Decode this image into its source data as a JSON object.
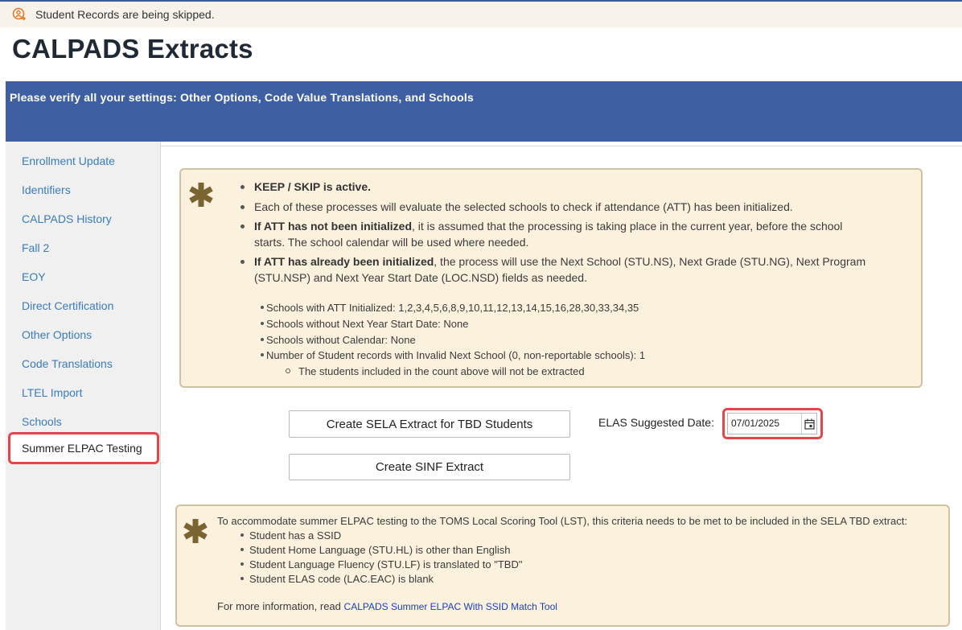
{
  "notice": {
    "text": "Student Records are being skipped.",
    "icon": "person-skip-icon"
  },
  "page": {
    "title": "CALPADS Extracts"
  },
  "banner": {
    "text": "Please verify all your settings: Other Options, Code Value Translations, and Schools"
  },
  "sidebar": {
    "items": [
      {
        "label": "Enrollment Update"
      },
      {
        "label": "Identifiers"
      },
      {
        "label": "CALPADS History"
      },
      {
        "label": "Fall 2"
      },
      {
        "label": "EOY"
      },
      {
        "label": "Direct Certification"
      },
      {
        "label": "Other Options"
      },
      {
        "label": "Code Translations"
      },
      {
        "label": "LTEL Import"
      },
      {
        "label": "Schools"
      }
    ],
    "active": {
      "label": "Summer ELPAC Testing"
    }
  },
  "info": {
    "b1": "KEEP / SKIP is active.",
    "b2": "Each of these processes will evaluate the selected schools to check if attendance (ATT) has been initialized.",
    "b3_bold": "If ATT has not been initialized",
    "b3_line1": ", it is assumed that the processing is taking place in the current year, before the school",
    "b3_line2": "starts. The school calendar will be used where needed.",
    "b4_bold": "If ATT has already been initialized",
    "b4_line1": ", the process will use the Next School (STU.NS), Next Grade (STU.NG), Next Program",
    "b4_line2": "(STU.NSP) and Next Year Start Date (LOC.NSD) fields as needed.",
    "details": [
      "Schools with ATT Initialized: 1,2,3,4,5,6,8,9,10,11,12,13,14,15,16,28,30,33,34,35",
      "Schools without Next Year Start Date: None",
      "Schools without Calendar: None",
      "Number of Student records with Invalid Next School (0, non-reportable schools): 1"
    ],
    "sub_detail": "The students included in the count above will not be extracted"
  },
  "actions": {
    "sela_button": "Create SELA Extract for TBD Students",
    "sinf_button": "Create SINF Extract",
    "date_label": "ELAS Suggested Date:",
    "date_value": "07/01/2025"
  },
  "criteria": {
    "intro": "To accommodate summer ELPAC testing to the TOMS Local Scoring Tool (LST), this criteria needs to be met to be included in the SELA TBD extract:",
    "items": [
      "Student has a SSID",
      "Student Home Language (STU.HL) is other than English",
      "Student Language Fluency (STU.LF) is translated to \"TBD\"",
      "Student ELAS code (LAC.EAC) is blank"
    ],
    "more_prefix": "For more information, read",
    "more_link": "CALPADS Summer ELPAC With SSID Match Tool"
  },
  "colors": {
    "banner": "#3f5fa3",
    "link": "#3a7bbf",
    "highlight": "#e2454b",
    "info_bg": "#fbf1dd",
    "asterisk": "#7a6532"
  }
}
